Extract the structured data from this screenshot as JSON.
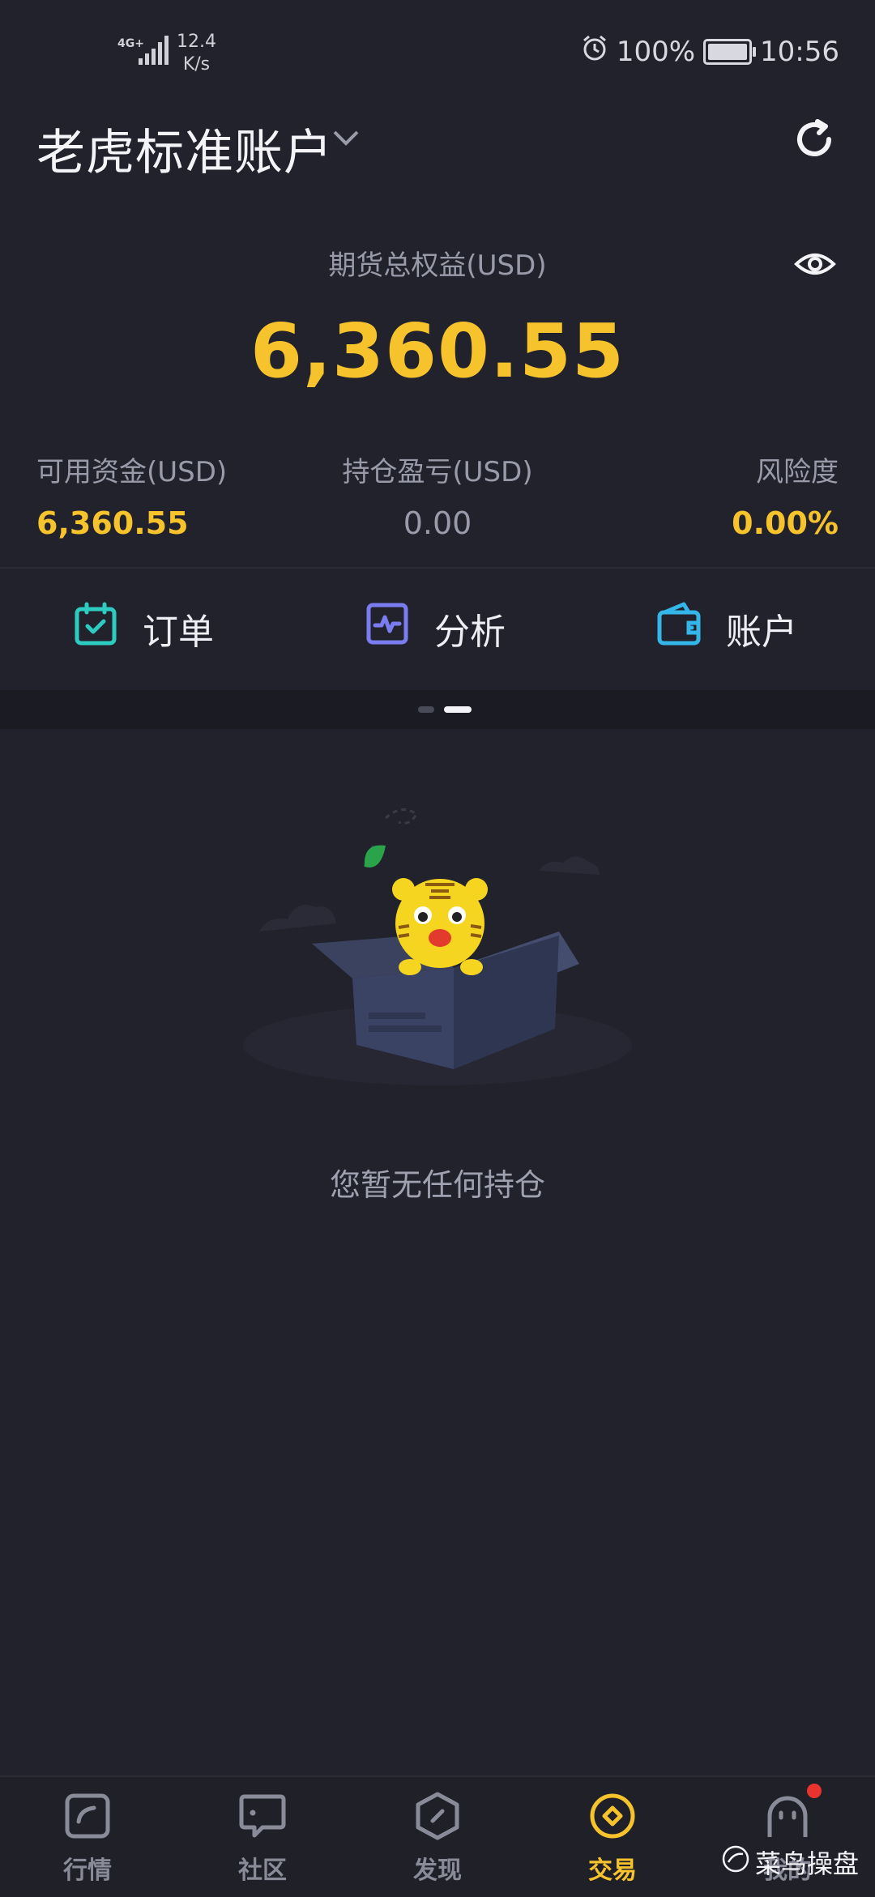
{
  "status": {
    "network": "4G+",
    "speed_value": "12.4",
    "speed_unit": "K/s",
    "battery": "100%",
    "time": "10:56"
  },
  "header": {
    "account_title": "老虎标准账户"
  },
  "equity": {
    "label": "期货总权益(USD)",
    "value": "6,360.55"
  },
  "stats": [
    {
      "label": "可用资金(USD)",
      "value": "6,360.55"
    },
    {
      "label": "持仓盈亏(USD)",
      "value": "0.00"
    },
    {
      "label": "风险度",
      "value": "0.00%"
    }
  ],
  "shortcuts": [
    {
      "label": "订单",
      "icon": "calendar-check-icon",
      "color": "#2ecbc0"
    },
    {
      "label": "分析",
      "icon": "pulse-chart-icon",
      "color": "#7b7cf0"
    },
    {
      "label": "账户",
      "icon": "wallet-icon",
      "color": "#35b6e8"
    }
  ],
  "empty": {
    "message": "您暂无任何持仓"
  },
  "tabs": [
    {
      "label": "行情",
      "icon": "chart-icon"
    },
    {
      "label": "社区",
      "icon": "chat-icon"
    },
    {
      "label": "发现",
      "icon": "compass-icon"
    },
    {
      "label": "交易",
      "icon": "trade-icon",
      "active": true
    },
    {
      "label": "我的",
      "icon": "profile-icon",
      "badge": true
    }
  ],
  "watermark": "菜鸟操盘",
  "colors": {
    "background": "#21222b",
    "accent": "#f7c32d",
    "muted": "#9a9baa"
  }
}
